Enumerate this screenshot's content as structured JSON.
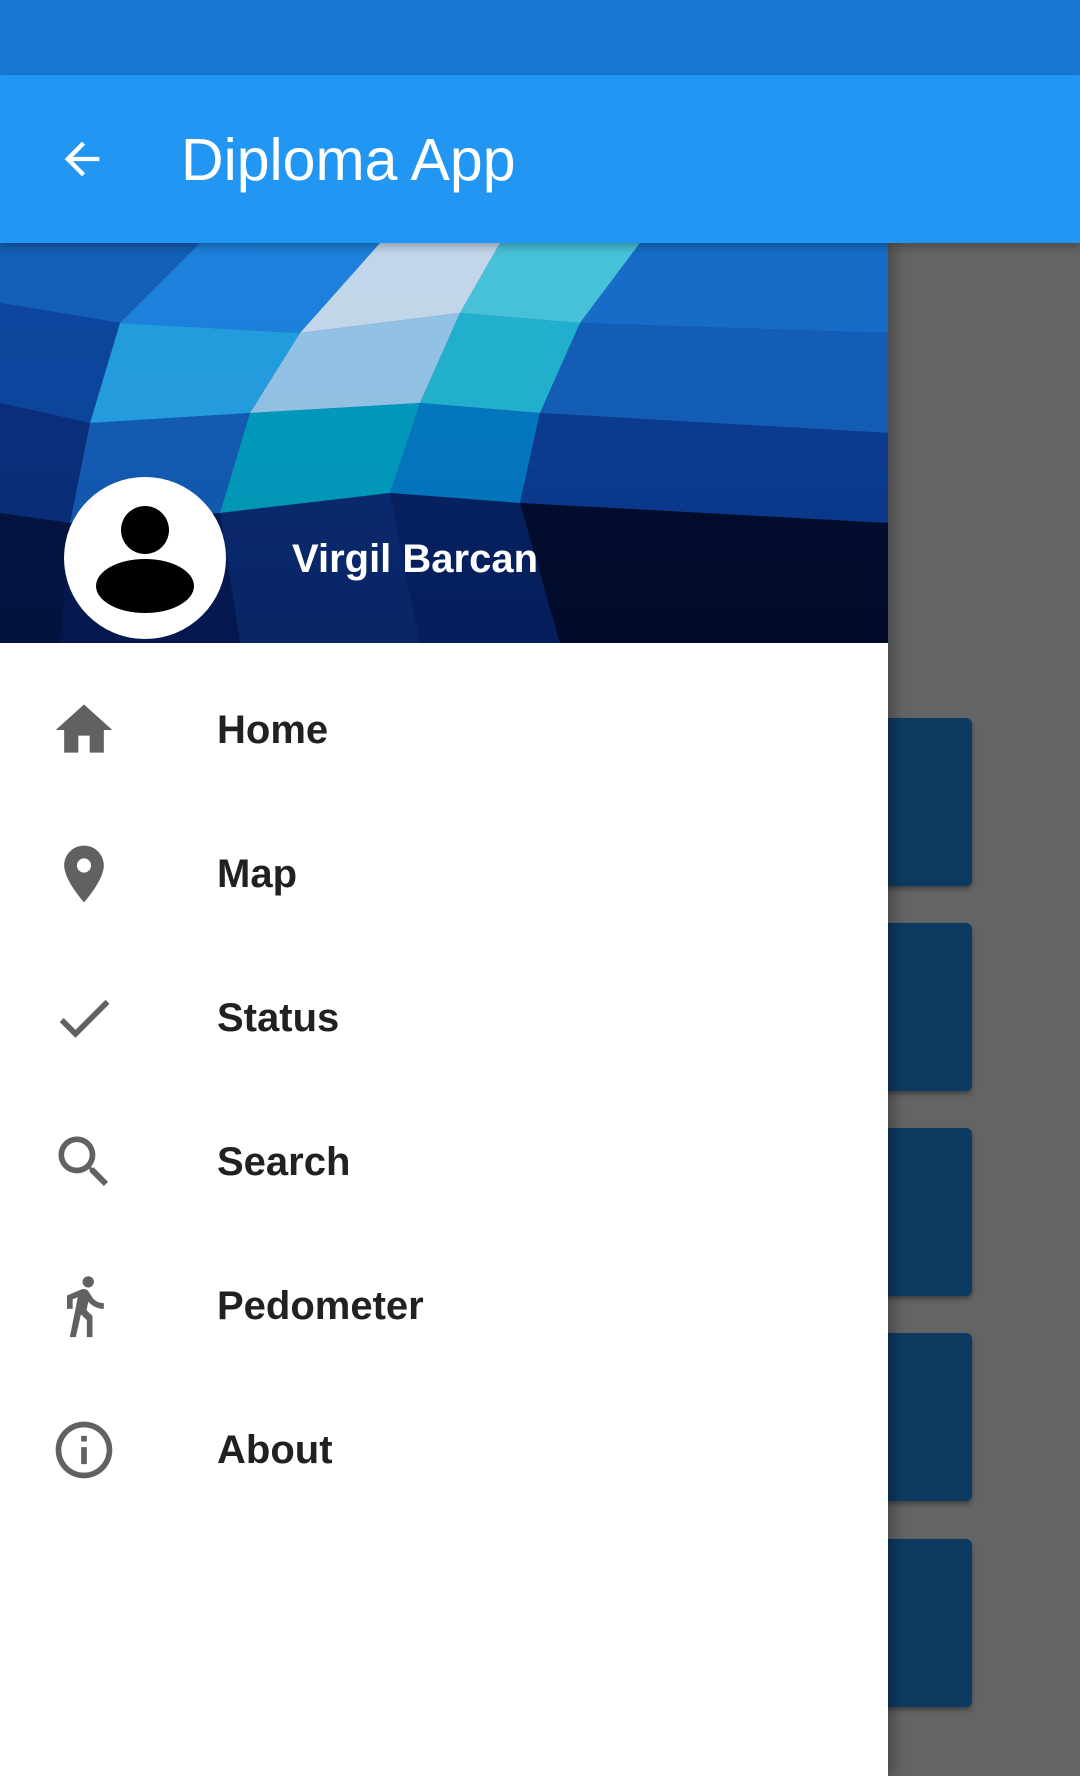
{
  "app_bar": {
    "title": "Diploma App",
    "back_icon": "arrow-back-icon"
  },
  "colors": {
    "status_bar": "#1976D2",
    "app_bar": "#2196F3",
    "scrim": "#616161",
    "card": "#0D3A60",
    "icon": "#616161",
    "text": "#212121"
  },
  "drawer": {
    "header": {
      "user_name": "Virgil Barcan",
      "avatar_icon": "account-circle-icon"
    },
    "items": [
      {
        "label": "Home",
        "icon": "home-icon"
      },
      {
        "label": "Map",
        "icon": "map-pin-icon"
      },
      {
        "label": "Status",
        "icon": "check-icon"
      },
      {
        "label": "Search",
        "icon": "search-icon"
      },
      {
        "label": "Pedometer",
        "icon": "walk-icon"
      },
      {
        "label": "About",
        "icon": "info-icon"
      }
    ]
  }
}
